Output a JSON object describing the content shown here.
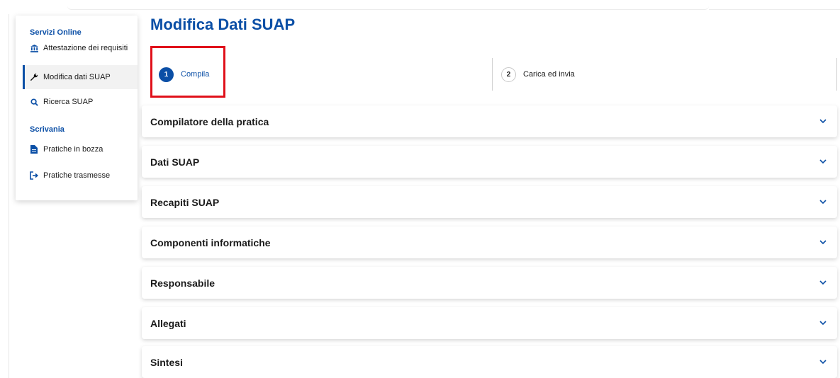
{
  "sidebar": {
    "section1": "Servizi Online",
    "items1": [
      {
        "label": "Attestazione dei requisiti",
        "icon": "bank-icon"
      },
      {
        "label": "Modifica dati SUAP",
        "icon": "wrench-icon",
        "active": true
      },
      {
        "label": "Ricerca SUAP",
        "icon": "search-icon"
      }
    ],
    "section2": "Scrivania",
    "items2": [
      {
        "label": "Pratiche in bozza",
        "icon": "file-icon"
      },
      {
        "label": "Pratiche trasmesse",
        "icon": "sign-out-icon"
      }
    ]
  },
  "page": {
    "title": "Modifica Dati SUAP"
  },
  "stepper": {
    "steps": [
      {
        "number": "1",
        "label": "Compila",
        "active": true
      },
      {
        "number": "2",
        "label": "Carica ed invia",
        "active": false
      }
    ]
  },
  "sections": [
    {
      "label": "Compilatore della pratica"
    },
    {
      "label": "Dati SUAP"
    },
    {
      "label": "Recapiti SUAP"
    },
    {
      "label": "Componenti informatiche"
    },
    {
      "label": "Responsabile"
    },
    {
      "label": "Allegati"
    },
    {
      "label": "Sintesi"
    }
  ],
  "colors": {
    "primary": "#0b4fa6",
    "highlight": "#e0101a"
  }
}
